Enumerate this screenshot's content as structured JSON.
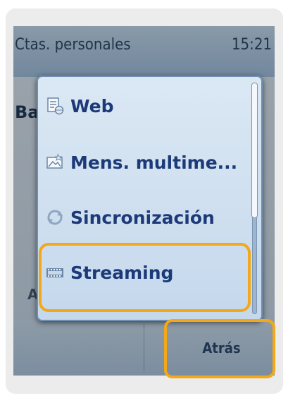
{
  "status": {
    "title": "Ctas. personales",
    "time": "15:21"
  },
  "background": {
    "fragment": "Ba",
    "fragment2": "A"
  },
  "menu": {
    "items": [
      {
        "label": "Web",
        "icon": "web-page-icon"
      },
      {
        "label": "Mens. multime...",
        "icon": "mms-icon"
      },
      {
        "label": "Sincronización",
        "icon": "sync-icon"
      },
      {
        "label": "Streaming",
        "icon": "streaming-film-icon"
      }
    ]
  },
  "softkeys": {
    "right": "Atrás"
  },
  "colors": {
    "highlight": "#f2a818",
    "text": "#1c3a78"
  }
}
